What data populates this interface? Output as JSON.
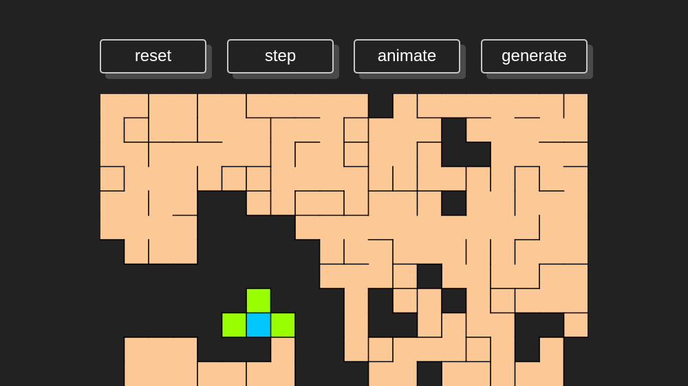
{
  "toolbar": {
    "reset_label": "reset",
    "step_label": "step",
    "animate_label": "animate",
    "generate_label": "generate"
  },
  "colors": {
    "background": "#222222",
    "carved_path": "#fcc895",
    "wall": "#000000",
    "uncarved": "#222222",
    "frontier": "#99ff00",
    "current_cell": "#00c8ff"
  },
  "maze": {
    "visible_columns": 20,
    "visible_rows": 12,
    "rows": [
      "CCCCCCCCCCCUCCCCCCCC",
      "CCCCCCCCCCCCCCUCCCCC",
      "CCCCCCCCCCCCCCUUCCCC",
      "CCCCCCCCCCCCCCCCCCCC",
      "CCCCUUCCCCCCCCUCCCCC",
      "CCCCUUUUCCCCCCCCCCCC",
      "UCCCUUUUUCCCCCCCCCCC",
      "UUUUUUUUUCCCCUCCCCCC",
      "UUUUUUFUUUCUCCUCCCCC",
      "UUUUUFXFUUCUUCCCCUUC",
      "UCCCUUUCUUCCCCCCCUCU",
      "UCCCCCCCUUUCCUCCCCCU"
    ]
  }
}
